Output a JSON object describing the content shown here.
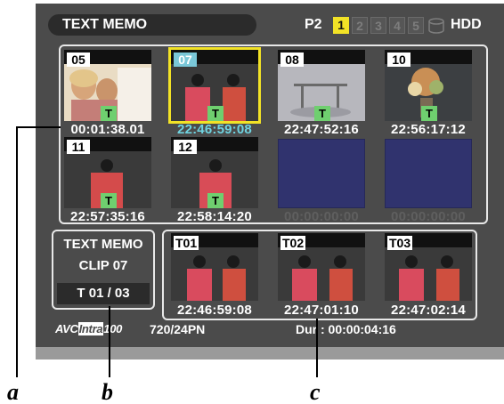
{
  "header": {
    "title": "TEXT MEMO",
    "p2_label": "P2",
    "slots": [
      "1",
      "2",
      "3",
      "4",
      "5"
    ],
    "active_slot": "1",
    "hdd_label": "HDD"
  },
  "clips": [
    {
      "num": "05",
      "tc": "00:01:38.01",
      "badge": "T"
    },
    {
      "num": "07",
      "tc": "22:46:59:08",
      "badge": "T",
      "selected": true
    },
    {
      "num": "08",
      "tc": "22:47:52:16",
      "badge": "T"
    },
    {
      "num": "10",
      "tc": "22:56:17:12",
      "badge": "T"
    },
    {
      "num": "11",
      "tc": "22:57:35:16",
      "badge": "T"
    },
    {
      "num": "12",
      "tc": "22:58:14:20",
      "badge": "T"
    }
  ],
  "empty_slots": [
    {
      "tc": "00:00:00:00"
    },
    {
      "tc": "00:00:00:00"
    }
  ],
  "memo_info": {
    "title": "TEXT MEMO",
    "clip": "CLIP 07",
    "count": "T 01  / 03"
  },
  "memos": [
    {
      "label": "T01",
      "tc": "22:46:59:08"
    },
    {
      "label": "T02",
      "tc": "22:47:01:10"
    },
    {
      "label": "T03",
      "tc": "22:47:02:14"
    }
  ],
  "status": {
    "codec_prefix": "AVC",
    "codec_intra": "Intra",
    "codec_suffix": "100",
    "format": "720/24PN",
    "duration": "Dur : 00:00:04:16"
  },
  "callouts": {
    "a": "a",
    "b": "b",
    "c": "c"
  },
  "colors": {
    "screen_bg": "#4b4b4b",
    "active_slot": "#f2e226",
    "selected_tc": "#6fd3e0",
    "badge": "#6fcf6f",
    "empty_slot": "#30336e"
  }
}
